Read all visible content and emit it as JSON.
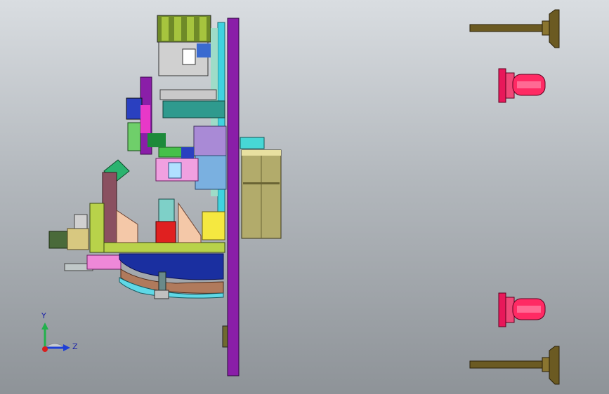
{
  "viewport": {
    "background_top": "#d9dde1",
    "background_bottom": "#8e9398"
  },
  "triad": {
    "y_label": "Y",
    "z_label": "Z",
    "y_color": "#22b14c",
    "z_color": "#1f3fd6",
    "x_color": "#d81e1e"
  },
  "colors": {
    "plate": "#8a1ea8",
    "motor_body": "#b2ab6b",
    "motor_cap": "#47d7d6",
    "caster": "#e8185a",
    "leveling_foot": "#6b5a22",
    "frame_green": "#b8d24a",
    "base_blue": "#1a2fa0",
    "base_brown": "#b07a5c"
  }
}
